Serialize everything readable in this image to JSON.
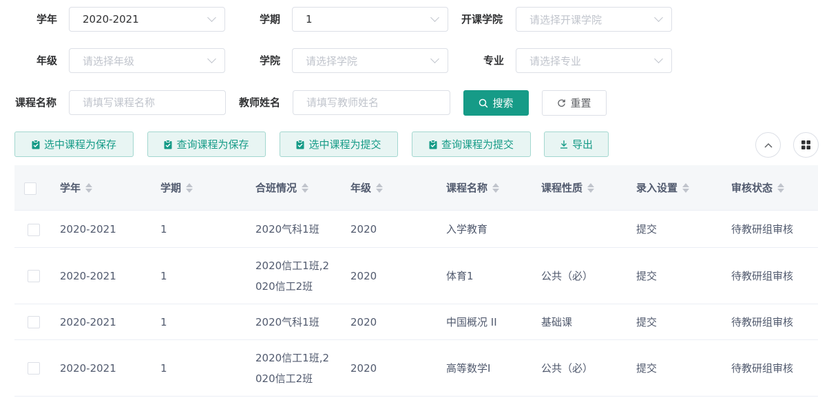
{
  "filters": {
    "year_label": "学年",
    "year_value": "2020-2021",
    "term_label": "学期",
    "term_value": "1",
    "college_open_label": "开课学院",
    "college_open_placeholder": "请选择开课学院",
    "grade_label": "年级",
    "grade_placeholder": "请选择年级",
    "college_label": "学院",
    "college_placeholder": "请选择学院",
    "major_label": "专业",
    "major_placeholder": "请选择专业",
    "course_label": "课程名称",
    "course_placeholder": "请填写课程名称",
    "teacher_label": "教师姓名",
    "teacher_placeholder": "请填写教师姓名",
    "search_label": "搜索",
    "reset_label": "重置"
  },
  "toolbar": {
    "save_selected": "选中课程为保存",
    "save_query": "查询课程为保存",
    "submit_selected": "选中课程为提交",
    "submit_query": "查询课程为提交",
    "export": "导出"
  },
  "icons": {
    "search": "search-icon",
    "reset": "refresh-icon",
    "clipboard": "clipboard-check-icon",
    "download": "download-icon",
    "collapse": "chevron-up-icon",
    "columns": "grid-icon"
  },
  "colors": {
    "primary": "#169b87",
    "light_bg": "#e8f5f3"
  },
  "table": {
    "headers": [
      "学年",
      "学期",
      "合班情况",
      "年级",
      "课程名称",
      "课程性质",
      "录入设置",
      "审核状态"
    ],
    "rows": [
      {
        "year": "2020-2021",
        "term": "1",
        "classes_1": "2020气科1班",
        "classes_2": "",
        "grade": "2020",
        "course": "入学教育",
        "nature": "",
        "entry": "提交",
        "status": "待教研组审核"
      },
      {
        "year": "2020-2021",
        "term": "1",
        "classes_1": "2020信工1班,2",
        "classes_2": "020信工2班",
        "grade": "2020",
        "course": "体育1",
        "nature": "公共（必）",
        "entry": "提交",
        "status": "待教研组审核"
      },
      {
        "year": "2020-2021",
        "term": "1",
        "classes_1": "2020气科1班",
        "classes_2": "",
        "grade": "2020",
        "course": "中国概况 II",
        "nature": "基础课",
        "entry": "提交",
        "status": "待教研组审核"
      },
      {
        "year": "2020-2021",
        "term": "1",
        "classes_1": "2020信工1班,2",
        "classes_2": "020信工2班",
        "grade": "2020",
        "course": "高等数学I",
        "nature": "公共（必）",
        "entry": "提交",
        "status": "待教研组审核"
      }
    ]
  }
}
